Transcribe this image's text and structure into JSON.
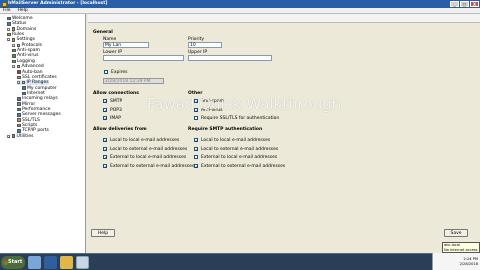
{
  "window": {
    "title": "hMailServer Administrator - [localhost]",
    "controls": [
      "_",
      "□",
      "X"
    ]
  },
  "menu": [
    "File",
    "Help"
  ],
  "tree": [
    {
      "label": "Welcome",
      "icon": "welcome-icon",
      "color": "#3a7bd5"
    },
    {
      "label": "Status",
      "icon": "status-icon",
      "color": "#3a7bd5"
    },
    {
      "label": "Domains",
      "icon": "domains-icon",
      "color": "#d4a017"
    },
    {
      "label": "Rules",
      "icon": "rules-icon",
      "color": "#d4a017"
    },
    {
      "label": "Settings",
      "icon": "settings-icon",
      "color": "#d4a017"
    },
    {
      "label": "Protocols",
      "icon": "folder-icon",
      "color": "#e8c33d"
    },
    {
      "label": "Anti-spam",
      "icon": "antispam-icon",
      "color": "#3aa04a"
    },
    {
      "label": "Anti-virus",
      "icon": "antivirus-icon",
      "color": "#3aa04a"
    },
    {
      "label": "Logging",
      "icon": "logging-icon",
      "color": "#888888"
    },
    {
      "label": "Advanced",
      "icon": "folder-icon",
      "color": "#e8c33d"
    },
    {
      "label": "Auto-ban",
      "icon": "autoban-icon",
      "color": "#c03030"
    },
    {
      "label": "SSL certificates",
      "icon": "certificate-icon",
      "color": "#d4a017"
    },
    {
      "label": "IP Ranges",
      "icon": "folder-icon",
      "color": "#e8c33d"
    },
    {
      "label": "My computer",
      "icon": "computer-icon",
      "color": "#3a7bd5"
    },
    {
      "label": "Internet",
      "icon": "internet-icon",
      "color": "#3a7bd5"
    },
    {
      "label": "Incoming relays",
      "icon": "relay-icon",
      "color": "#3a7bd5"
    },
    {
      "label": "Mirror",
      "icon": "mirror-icon",
      "color": "#888888"
    },
    {
      "label": "Performance",
      "icon": "performance-icon",
      "color": "#3aa04a"
    },
    {
      "label": "Server messages",
      "icon": "messages-icon",
      "color": "#3a7bd5"
    },
    {
      "label": "SSL/TLS",
      "icon": "ssl-icon",
      "color": "#d4a017"
    },
    {
      "label": "Scripts",
      "icon": "scripts-icon",
      "color": "#888888"
    },
    {
      "label": "TCP/IP ports",
      "icon": "ports-icon",
      "color": "#3a7bd5"
    },
    {
      "label": "Utilities",
      "icon": "utilities-icon",
      "color": "#888888"
    }
  ],
  "form": {
    "general_heading": "General",
    "name_label": "Name",
    "name_value": "My Lan",
    "priority_label": "Priority",
    "priority_value": "10",
    "lower_ip_label": "Lower IP",
    "lower_ip_value": "",
    "upper_ip_label": "Upper IP",
    "upper_ip_value": "",
    "expires_label": "Expires",
    "expires_value": "2/28/2018 12:39 PM",
    "allow_connections_heading": "Allow connections",
    "connections": [
      {
        "label": "SMTP",
        "checked": true
      },
      {
        "label": "POP3",
        "checked": true
      },
      {
        "label": "IMAP",
        "checked": true
      }
    ],
    "other_heading": "Other",
    "other": [
      {
        "label": "Anti-spam",
        "checked": true
      },
      {
        "label": "Anti-virus",
        "checked": true
      },
      {
        "label": "Require SSL/TLS for authentication",
        "checked": false
      }
    ],
    "deliveries_heading": "Allow deliveries from",
    "deliveries": [
      {
        "label": "Local to local e-mail addresses",
        "checked": true
      },
      {
        "label": "Local to external e-mail addresses",
        "checked": true
      },
      {
        "label": "External to local e-mail addresses",
        "checked": true
      },
      {
        "label": "External to external e-mail addresses",
        "checked": true
      }
    ],
    "smtp_auth_heading": "Require SMTP authentication",
    "smtp_auth": [
      {
        "label": "Local to local e-mail addresses",
        "checked": true
      },
      {
        "label": "Local to external e-mail addresses",
        "checked": true
      },
      {
        "label": "External to local e-mail addresses",
        "checked": false
      },
      {
        "label": "External to external e-mail addresses",
        "checked": true
      }
    ],
    "help_button": "Help",
    "save_button": "Save"
  },
  "watermark": "Fawad Quick Walkthrough",
  "taskbar": {
    "start_label": "Start",
    "clock_time": "2:24 PM",
    "clock_date": "2/28/2018"
  },
  "notification": {
    "line1": "abc.local",
    "line2": "No Internet access"
  }
}
